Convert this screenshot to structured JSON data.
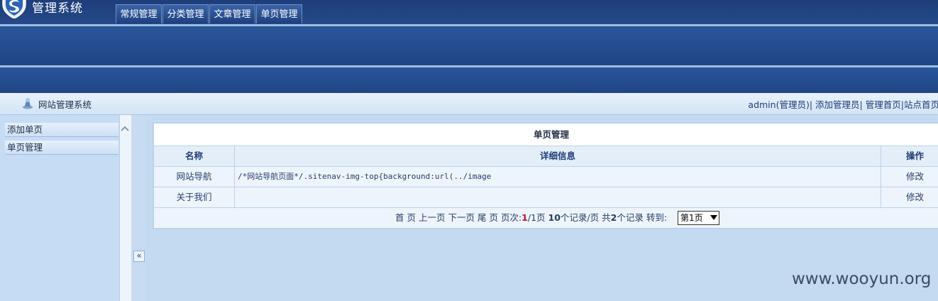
{
  "header": {
    "app_title": "管理系统",
    "nav_tabs": [
      {
        "label": "常规管理"
      },
      {
        "label": "分类管理"
      },
      {
        "label": "文章管理"
      },
      {
        "label": "单页管理"
      }
    ]
  },
  "infobar": {
    "site_name": "网站管理系统",
    "user": "admin(管理员)",
    "sep": "|",
    "add_admin": "添加管理员",
    "admin_home": "管理首页",
    "site_home": "站点首页"
  },
  "sidebar": {
    "items": [
      {
        "label": "添加单页"
      },
      {
        "label": "单页管理"
      }
    ],
    "collapse_label": "«"
  },
  "table": {
    "title": "单页管理",
    "headers": {
      "name": "名称",
      "detail": "详细信息",
      "action": "操作"
    },
    "rows": [
      {
        "name": "网站导航",
        "detail": "/*网站导航页面*/.sitenav-img-top{background:url(../image",
        "action": "修改"
      },
      {
        "name": "关于我们",
        "detail": "",
        "action": "修改"
      }
    ]
  },
  "pager": {
    "first": "首 页",
    "prev": "上一页",
    "next": "下一页",
    "last": "尾 页",
    "page_label": "页次:",
    "current": "1",
    "total_pages": "/1页",
    "per_page_num": "10",
    "per_page_label": "个记录/页",
    "total_label_pre": "共",
    "total_num": "2",
    "total_label_post": "个记录",
    "goto_label": "转到:",
    "select_value": "第1页"
  },
  "watermark": "www.wooyun.org",
  "colors": {
    "header_blue": "#26508f",
    "panel_light": "#c4daf0",
    "current_page_red": "#c8102e"
  }
}
